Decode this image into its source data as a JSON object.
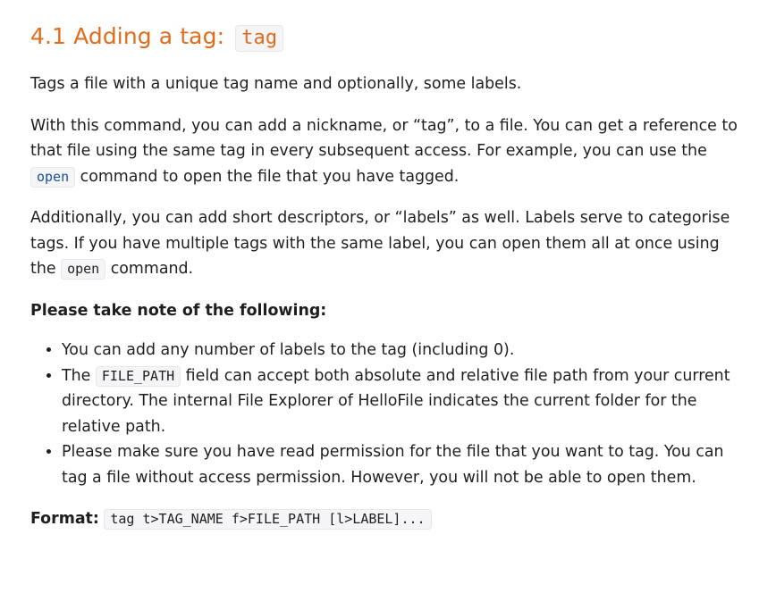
{
  "heading": {
    "text": "4.1 Adding a tag: ",
    "code": "tag"
  },
  "summary": "Tags a file with a unique tag name and optionally, some labels.",
  "paragraph1": {
    "before": "With this command, you can add a nickname, or “tag”, to a file. You can get a reference to that file using the same tag in every subsequent access. For example, you can use the ",
    "code": "open",
    "after": " command to open the file that you have tagged."
  },
  "paragraph2": {
    "before": "Additionally, you can add short descriptors, or “labels” as well. Labels serve to categorise tags. If you have multiple tags with the same label, you can open them all at once using the ",
    "code": "open",
    "after": " command."
  },
  "note_heading": "Please take note of the following:",
  "notes": [
    {
      "text": "You can add any number of labels to the tag (including 0)."
    },
    {
      "before": "The ",
      "code": "FILE_PATH",
      "after": " field can accept both absolute and relative file path from your current directory. The internal File Explorer of HelloFile indicates the current folder for the relative path."
    },
    {
      "text": "Please make sure you have read permission for the file that you want to tag. You can tag a file without access permission. However, you will not be able to open them."
    }
  ],
  "format": {
    "label": "Format:",
    "code": "tag t>TAG_NAME f>FILE_PATH [l>LABEL]..."
  },
  "colors": {
    "heading": "#e06c1c",
    "code_link": "#1a4f9c",
    "code_bg": "#f5f5f7"
  }
}
